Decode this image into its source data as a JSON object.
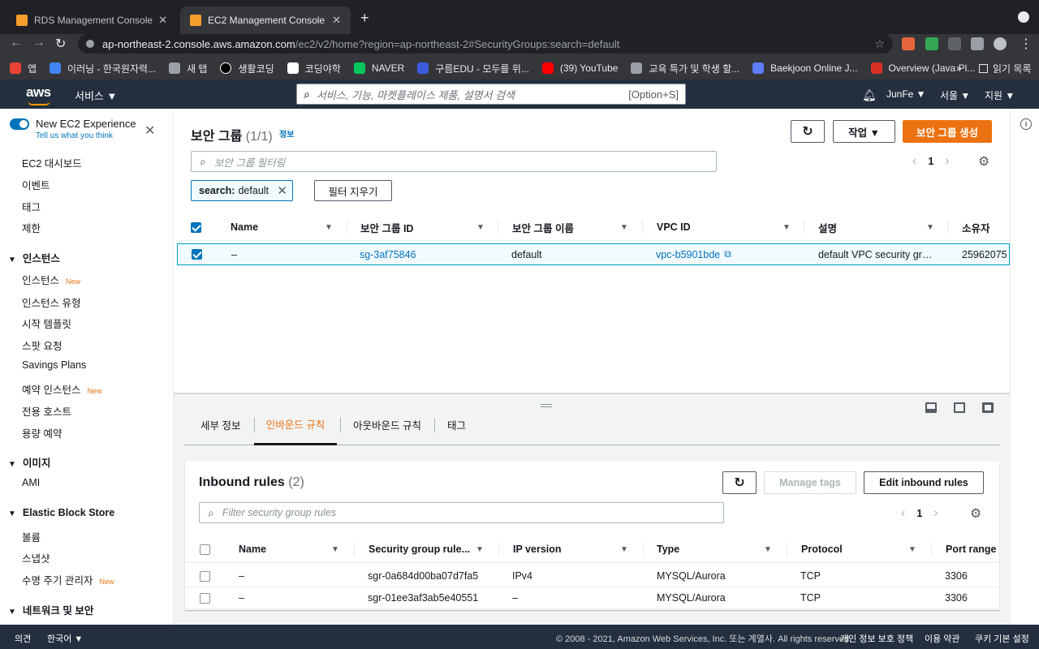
{
  "browser": {
    "tabs": [
      {
        "title": "RDS Management Console",
        "active": false
      },
      {
        "title": "EC2 Management Console",
        "active": true
      }
    ],
    "url_host": "ap-northeast-2.console.aws.amazon.com",
    "url_path": "/ec2/v2/home?region=ap-northeast-2#SecurityGroups:search=default",
    "bookmarks": [
      {
        "label": "앱",
        "color": "#ea4335"
      },
      {
        "label": "이러닝 - 한국원자력...",
        "color": "#4285f4"
      },
      {
        "label": "새 탭",
        "color": "#9aa0a6"
      },
      {
        "label": "생활코딩",
        "color": "#000000"
      },
      {
        "label": "코딩야학",
        "color": "#ffffff"
      },
      {
        "label": "NAVER",
        "color": "#03c75a"
      },
      {
        "label": "구름EDU - 모두를 위...",
        "color": "#3b5bdb"
      },
      {
        "label": "(39) YouTube",
        "color": "#ff0000"
      },
      {
        "label": "교육 특가 및 학생 할...",
        "color": "#9aa0a6"
      },
      {
        "label": "Baekjoon Online J...",
        "color": "#5c7cfa"
      },
      {
        "label": "Overview (Java Pl...",
        "color": "#d93025"
      }
    ],
    "bookmarks_more": "»",
    "reading_list": "읽기 목록"
  },
  "aws_header": {
    "logo": "aws",
    "services": "서비스 ▼",
    "search_placeholder": "서비스, 기능, 마켓플레이스 제품, 설명서 검색",
    "search_hint": "[Option+S]",
    "user": "JunFe ▼",
    "region": "서울 ▼",
    "support": "지원 ▼"
  },
  "sidebar": {
    "experience_title": "New EC2 Experience",
    "experience_sub": "Tell us what you think",
    "top_items": [
      "EC2 대시보드",
      "이벤트",
      "태그",
      "제한"
    ],
    "sections": [
      {
        "title": "인스턴스",
        "items": [
          {
            "label": "인스턴스",
            "new": "New"
          },
          {
            "label": "인스턴스 유형",
            "new": ""
          },
          {
            "label": "시작 템플릿",
            "new": ""
          },
          {
            "label": "스팟 요청",
            "new": ""
          },
          {
            "label": "Savings Plans",
            "new": ""
          },
          {
            "label": "예약 인스턴스",
            "new": "New"
          },
          {
            "label": "전용 호스트",
            "new": ""
          },
          {
            "label": "용량 예약",
            "new": ""
          }
        ]
      },
      {
        "title": "이미지",
        "items": [
          {
            "label": "AMI",
            "new": ""
          }
        ]
      },
      {
        "title": "Elastic Block Store",
        "items": [
          {
            "label": "볼륨",
            "new": ""
          },
          {
            "label": "스냅샷",
            "new": ""
          },
          {
            "label": "수명 주기 관리자",
            "new": "New"
          }
        ]
      },
      {
        "title": "네트워크 및 보안",
        "items": []
      }
    ]
  },
  "security_groups": {
    "title": "보안 그룹",
    "count": "(1/1)",
    "info": "정보",
    "actions_label": "작업 ▼",
    "create_label": "보안 그룹 생성",
    "filter_placeholder": "보안 그룹 필터링",
    "token_key": "search:",
    "token_value": "default",
    "clear_filters": "필터 지우기",
    "page": "1",
    "columns": [
      "Name",
      "보안 그룹 ID",
      "보안 그룹 이름",
      "VPC ID",
      "설명",
      "소유자"
    ],
    "row": {
      "name": "–",
      "sg_id": "sg-3af75846",
      "sg_name": "default",
      "vpc_id": "vpc-b5901bde",
      "description": "default VPC security gr…",
      "owner": "25962075"
    }
  },
  "details": {
    "tabs": [
      "세부 정보",
      "인바운드 규칙",
      "아웃바운드 규칙",
      "태그"
    ],
    "active_tab": 1,
    "inbound_title": "Inbound rules",
    "inbound_count": "(2)",
    "manage_tags": "Manage tags",
    "edit_inbound": "Edit inbound rules",
    "filter_placeholder": "Filter security group rules",
    "page": "1",
    "columns": [
      "Name",
      "Security group rule...",
      "IP version",
      "Type",
      "Protocol",
      "Port range"
    ],
    "rows": [
      {
        "name": "–",
        "rule_id": "sgr-0a684d00ba07d7fa5",
        "ip_version": "IPv4",
        "type": "MYSQL/Aurora",
        "protocol": "TCP",
        "port": "3306"
      },
      {
        "name": "–",
        "rule_id": "sgr-01ee3af3ab5e40551",
        "ip_version": "–",
        "type": "MYSQL/Aurora",
        "protocol": "TCP",
        "port": "3306"
      }
    ]
  },
  "footer": {
    "feedback": "의견",
    "language": "한국어 ▼",
    "copyright": "© 2008 - 2021, Amazon Web Services, Inc. 또는 계열사. All rights reserved.",
    "privacy": "개인 정보 보호 정책",
    "terms": "이용 약관",
    "cookies": "쿠키 기본 설정"
  },
  "colors": {
    "aws_orange": "#ec7211",
    "aws_navy": "#232f3e",
    "link_blue": "#0073bb"
  }
}
